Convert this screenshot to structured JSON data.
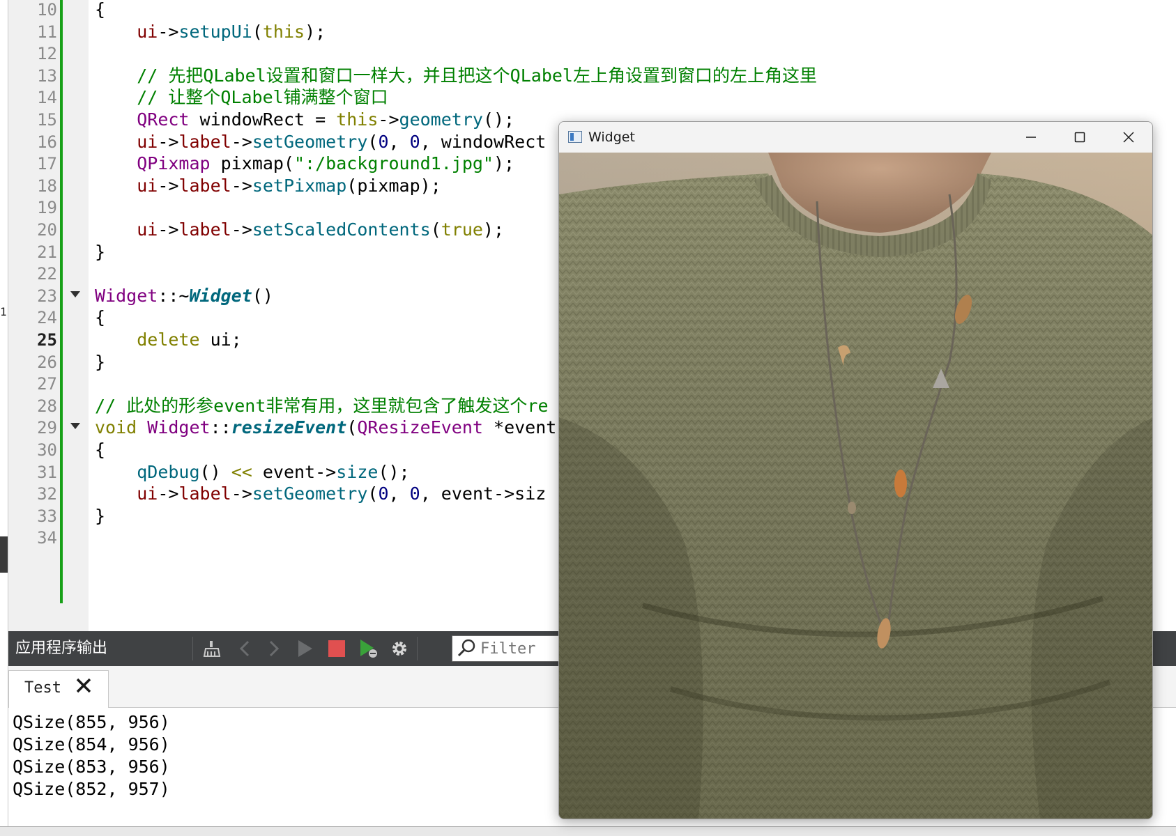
{
  "editor": {
    "lines": [
      {
        "num": "10",
        "tokens": [
          {
            "c": "pl",
            "t": "{"
          }
        ]
      },
      {
        "num": "11",
        "tokens": [
          {
            "c": "pl",
            "t": "    "
          },
          {
            "c": "mem",
            "t": "ui"
          },
          {
            "c": "pl",
            "t": "->"
          },
          {
            "c": "fn",
            "t": "setupUi"
          },
          {
            "c": "pl",
            "t": "("
          },
          {
            "c": "kw",
            "t": "this"
          },
          {
            "c": "pl",
            "t": ");"
          }
        ]
      },
      {
        "num": "12",
        "tokens": []
      },
      {
        "num": "13",
        "tokens": [
          {
            "c": "cm",
            "t": "    // 先把QLabel设置和窗口一样大，并且把这个QLabel左上角设置到窗口的左上角这里"
          }
        ]
      },
      {
        "num": "14",
        "tokens": [
          {
            "c": "cm",
            "t": "    // 让整个QLabel铺满整个窗口"
          }
        ]
      },
      {
        "num": "15",
        "tokens": [
          {
            "c": "pl",
            "t": "    "
          },
          {
            "c": "ty",
            "t": "QRect"
          },
          {
            "c": "pl",
            "t": " windowRect = "
          },
          {
            "c": "kw",
            "t": "this"
          },
          {
            "c": "pl",
            "t": "->"
          },
          {
            "c": "fn",
            "t": "geometry"
          },
          {
            "c": "pl",
            "t": "();"
          }
        ]
      },
      {
        "num": "16",
        "tokens": [
          {
            "c": "pl",
            "t": "    "
          },
          {
            "c": "mem",
            "t": "ui"
          },
          {
            "c": "pl",
            "t": "->"
          },
          {
            "c": "mem",
            "t": "label"
          },
          {
            "c": "pl",
            "t": "->"
          },
          {
            "c": "fn",
            "t": "setGeometry"
          },
          {
            "c": "pl",
            "t": "("
          },
          {
            "c": "num-lit",
            "t": "0"
          },
          {
            "c": "pl",
            "t": ", "
          },
          {
            "c": "num-lit",
            "t": "0"
          },
          {
            "c": "pl",
            "t": ", windowRect"
          }
        ]
      },
      {
        "num": "17",
        "tokens": [
          {
            "c": "pl",
            "t": "    "
          },
          {
            "c": "ty",
            "t": "QPixmap"
          },
          {
            "c": "pl",
            "t": " pixmap("
          },
          {
            "c": "str",
            "t": "\":/background1.jpg\""
          },
          {
            "c": "pl",
            "t": ");"
          }
        ]
      },
      {
        "num": "18",
        "tokens": [
          {
            "c": "pl",
            "t": "    "
          },
          {
            "c": "mem",
            "t": "ui"
          },
          {
            "c": "pl",
            "t": "->"
          },
          {
            "c": "mem",
            "t": "label"
          },
          {
            "c": "pl",
            "t": "->"
          },
          {
            "c": "fn",
            "t": "setPixmap"
          },
          {
            "c": "pl",
            "t": "(pixmap);"
          }
        ]
      },
      {
        "num": "19",
        "tokens": []
      },
      {
        "num": "20",
        "tokens": [
          {
            "c": "pl",
            "t": "    "
          },
          {
            "c": "mem",
            "t": "ui"
          },
          {
            "c": "pl",
            "t": "->"
          },
          {
            "c": "mem",
            "t": "label"
          },
          {
            "c": "pl",
            "t": "->"
          },
          {
            "c": "fn",
            "t": "setScaledContents"
          },
          {
            "c": "pl",
            "t": "("
          },
          {
            "c": "kw",
            "t": "true"
          },
          {
            "c": "pl",
            "t": ");"
          }
        ]
      },
      {
        "num": "21",
        "tokens": [
          {
            "c": "pl",
            "t": "}"
          }
        ]
      },
      {
        "num": "22",
        "tokens": []
      },
      {
        "num": "23",
        "fold": true,
        "tokens": [
          {
            "c": "ty",
            "t": "Widget"
          },
          {
            "c": "pl",
            "t": "::~"
          },
          {
            "c": "fni",
            "t": "Widget"
          },
          {
            "c": "pl",
            "t": "()"
          }
        ]
      },
      {
        "num": "24",
        "tokens": [
          {
            "c": "pl",
            "t": "{"
          }
        ]
      },
      {
        "num": "25",
        "current": true,
        "tokens": [
          {
            "c": "pl",
            "t": "    "
          },
          {
            "c": "kw",
            "t": "delete"
          },
          {
            "c": "pl",
            "t": " ui;"
          }
        ]
      },
      {
        "num": "26",
        "tokens": [
          {
            "c": "pl",
            "t": "}"
          }
        ]
      },
      {
        "num": "27",
        "tokens": []
      },
      {
        "num": "28",
        "tokens": [
          {
            "c": "cm",
            "t": "// 此处的形参event非常有用，这里就包含了触发这个re"
          }
        ]
      },
      {
        "num": "29",
        "fold": true,
        "tokens": [
          {
            "c": "kw",
            "t": "void"
          },
          {
            "c": "pl",
            "t": " "
          },
          {
            "c": "ty",
            "t": "Widget"
          },
          {
            "c": "pl",
            "t": "::"
          },
          {
            "c": "fni",
            "t": "resizeEvent"
          },
          {
            "c": "pl",
            "t": "("
          },
          {
            "c": "ty",
            "t": "QResizeEvent"
          },
          {
            "c": "pl",
            "t": " *event"
          }
        ]
      },
      {
        "num": "30",
        "tokens": [
          {
            "c": "pl",
            "t": "{"
          }
        ]
      },
      {
        "num": "31",
        "tokens": [
          {
            "c": "pl",
            "t": "    "
          },
          {
            "c": "fn",
            "t": "qDebug"
          },
          {
            "c": "pl",
            "t": "() "
          },
          {
            "c": "kw",
            "t": "<<"
          },
          {
            "c": "pl",
            "t": " event->"
          },
          {
            "c": "fn",
            "t": "size"
          },
          {
            "c": "pl",
            "t": "();"
          }
        ]
      },
      {
        "num": "32",
        "tokens": [
          {
            "c": "pl",
            "t": "    "
          },
          {
            "c": "mem",
            "t": "ui"
          },
          {
            "c": "pl",
            "t": "->"
          },
          {
            "c": "mem",
            "t": "label"
          },
          {
            "c": "pl",
            "t": "->"
          },
          {
            "c": "fn",
            "t": "setGeometry"
          },
          {
            "c": "pl",
            "t": "("
          },
          {
            "c": "num-lit",
            "t": "0"
          },
          {
            "c": "pl",
            "t": ", "
          },
          {
            "c": "num-lit",
            "t": "0"
          },
          {
            "c": "pl",
            "t": ", event->siz"
          }
        ]
      },
      {
        "num": "33",
        "tokens": [
          {
            "c": "pl",
            "t": "}"
          }
        ]
      },
      {
        "num": "34",
        "tokens": []
      }
    ]
  },
  "output": {
    "title": "应用程序输出",
    "toolbar_icons": [
      "clear-icon",
      "prev-icon",
      "next-icon",
      "run-icon",
      "stop-icon",
      "debug-run-icon",
      "settings-icon"
    ],
    "filter_placeholder": "Filter",
    "tab_label": "Test",
    "log": [
      "QSize(855, 956)",
      "QSize(854, 956)",
      "QSize(853, 956)",
      "QSize(852, 957)"
    ]
  },
  "widget_window": {
    "title": "Widget",
    "minimize_icon": "minimize-icon",
    "maximize_icon": "maximize-icon",
    "close_icon": "close-icon",
    "image_subject": "knit sweater with necklace"
  },
  "colors": {
    "toolbar_bg": "#404244",
    "modified_bar": "#18a018",
    "stop_red": "#e05050",
    "run_green": "#3aa23a",
    "sweater": "#8a8a6a"
  }
}
